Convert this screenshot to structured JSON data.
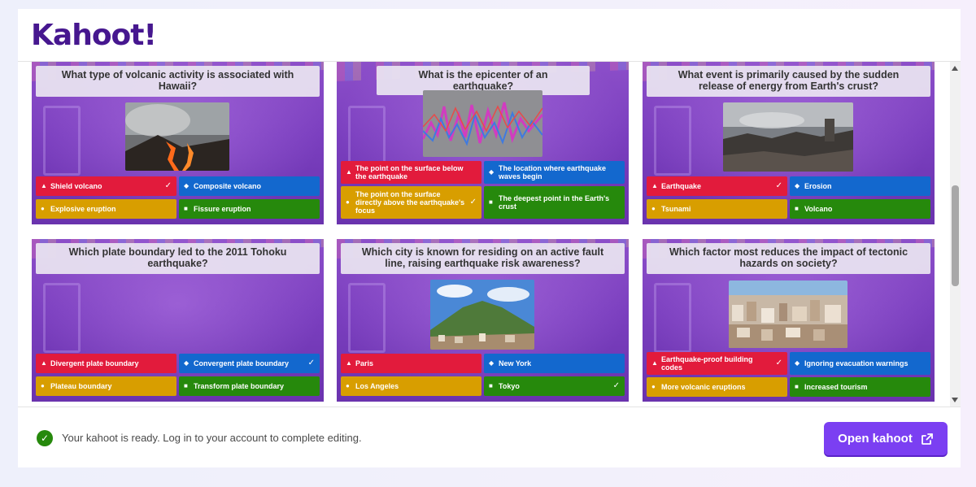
{
  "app": {
    "logo_text": "Kahoot!",
    "colors": {
      "brand": "#46178f",
      "red": "#e21b3c",
      "blue": "#1368ce",
      "yellow": "#d89e00",
      "green": "#26890c",
      "button": "#7b3ff2"
    }
  },
  "cards": [
    {
      "question": "What type of volcanic activity is associated with Hawaii?",
      "media": "lava-photo",
      "answers": [
        {
          "text": "Shield volcano",
          "color": "red",
          "shape": "triangle",
          "correct": true
        },
        {
          "text": "Composite volcano",
          "color": "blue",
          "shape": "diamond",
          "correct": false
        },
        {
          "text": "Explosive eruption",
          "color": "yellow",
          "shape": "circle",
          "correct": false
        },
        {
          "text": "Fissure eruption",
          "color": "green",
          "shape": "square",
          "correct": false
        }
      ]
    },
    {
      "question": "What is the epicenter of an earthquake?",
      "media": "seismograph-photo",
      "answers": [
        {
          "text": "The point on the surface below the earthquake",
          "color": "red",
          "shape": "triangle",
          "correct": false
        },
        {
          "text": "The location where earthquake waves begin",
          "color": "blue",
          "shape": "diamond",
          "correct": false
        },
        {
          "text": "The point on the surface directly above the earthquake's focus",
          "color": "yellow",
          "shape": "circle",
          "correct": true
        },
        {
          "text": "The deepest point in the Earth's crust",
          "color": "green",
          "shape": "square",
          "correct": false
        }
      ]
    },
    {
      "question": "What event is primarily caused by the sudden release of energy from Earth's crust?",
      "media": "ruins-photo",
      "answers": [
        {
          "text": "Earthquake",
          "color": "red",
          "shape": "triangle",
          "correct": true
        },
        {
          "text": "Erosion",
          "color": "blue",
          "shape": "diamond",
          "correct": false
        },
        {
          "text": "Tsunami",
          "color": "yellow",
          "shape": "circle",
          "correct": false
        },
        {
          "text": "Volcano",
          "color": "green",
          "shape": "square",
          "correct": false
        }
      ]
    },
    {
      "question": "Which plate boundary led to the 2011 Tohoku earthquake?",
      "media": "",
      "answers": [
        {
          "text": "Divergent plate boundary",
          "color": "red",
          "shape": "triangle",
          "correct": false
        },
        {
          "text": "Convergent plate boundary",
          "color": "blue",
          "shape": "diamond",
          "correct": true
        },
        {
          "text": "Plateau boundary",
          "color": "yellow",
          "shape": "circle",
          "correct": false
        },
        {
          "text": "Transform plate boundary",
          "color": "green",
          "shape": "square",
          "correct": false
        }
      ]
    },
    {
      "question": "Which city is known for residing on an active fault line, raising earthquake risk awareness?",
      "media": "mountain-city-photo",
      "answers": [
        {
          "text": "Paris",
          "color": "red",
          "shape": "triangle",
          "correct": false
        },
        {
          "text": "New York",
          "color": "blue",
          "shape": "diamond",
          "correct": false
        },
        {
          "text": "Los Angeles",
          "color": "yellow",
          "shape": "circle",
          "correct": false
        },
        {
          "text": "Tokyo",
          "color": "green",
          "shape": "square",
          "correct": true
        }
      ]
    },
    {
      "question": "Which factor most reduces the impact of tectonic hazards on society?",
      "media": "dense-city-photo",
      "answers": [
        {
          "text": "Earthquake-proof building codes",
          "color": "red",
          "shape": "triangle",
          "correct": true
        },
        {
          "text": "Ignoring evacuation warnings",
          "color": "blue",
          "shape": "diamond",
          "correct": false
        },
        {
          "text": "More volcanic eruptions",
          "color": "yellow",
          "shape": "circle",
          "correct": false
        },
        {
          "text": "Increased tourism",
          "color": "green",
          "shape": "square",
          "correct": false
        }
      ]
    }
  ],
  "footer": {
    "status_text": "Your kahoot is ready. Log in to your account to complete editing.",
    "open_button_label": "Open kahoot"
  }
}
